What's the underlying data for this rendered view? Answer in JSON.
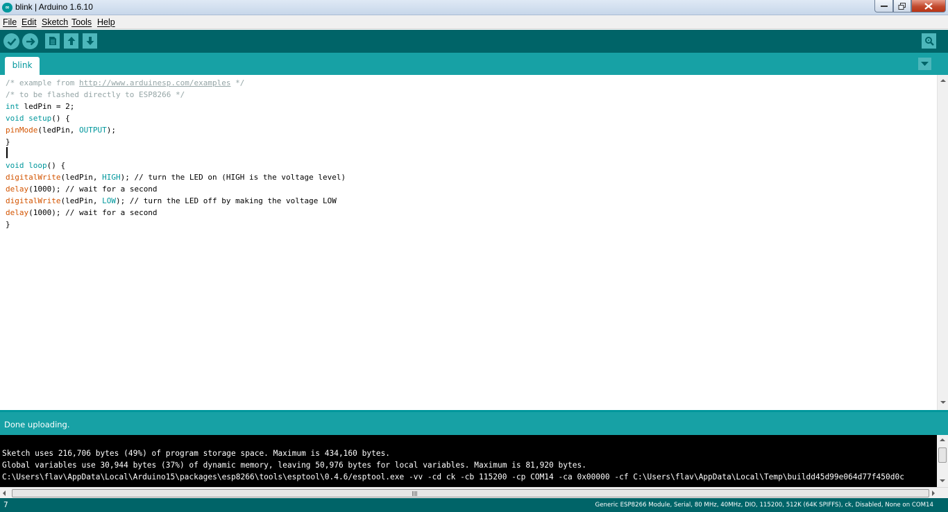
{
  "window": {
    "title": "blink | Arduino 1.6.10",
    "app_icon_text": "∞"
  },
  "menu": {
    "items": [
      "File",
      "Edit",
      "Sketch",
      "Tools",
      "Help"
    ]
  },
  "toolbar": {
    "buttons": [
      "verify-icon",
      "upload-icon",
      "new-icon",
      "open-icon",
      "save-icon"
    ],
    "serial_monitor_icon": "magnifier-icon"
  },
  "tabs": {
    "active": "blink"
  },
  "editor": {
    "lines": [
      {
        "parts": [
          {
            "t": "/* example from ",
            "c": "cmt"
          },
          {
            "t": "http://www.arduinesp.com/examples",
            "c": "link"
          },
          {
            "t": " */",
            "c": "cmt"
          }
        ]
      },
      {
        "parts": [
          {
            "t": "/* to be flashed directly to ESP8266 */",
            "c": "cmt"
          }
        ]
      },
      {
        "parts": [
          {
            "t": "int",
            "c": "kw"
          },
          {
            "t": " ledPin = 2;",
            "c": ""
          }
        ]
      },
      {
        "parts": [
          {
            "t": "void",
            "c": "kw"
          },
          {
            "t": " ",
            "c": ""
          },
          {
            "t": "setup",
            "c": "kw"
          },
          {
            "t": "() {",
            "c": ""
          }
        ]
      },
      {
        "parts": [
          {
            "t": "pinMode",
            "c": "fn"
          },
          {
            "t": "(ledPin, ",
            "c": ""
          },
          {
            "t": "OUTPUT",
            "c": "cst"
          },
          {
            "t": ");",
            "c": ""
          }
        ]
      },
      {
        "parts": [
          {
            "t": "}",
            "c": ""
          }
        ]
      },
      {
        "parts": [
          {
            "t": "",
            "c": ""
          }
        ]
      },
      {
        "parts": [
          {
            "t": "void",
            "c": "kw"
          },
          {
            "t": " ",
            "c": ""
          },
          {
            "t": "loop",
            "c": "kw"
          },
          {
            "t": "() {",
            "c": ""
          }
        ]
      },
      {
        "parts": [
          {
            "t": "digitalWrite",
            "c": "fn"
          },
          {
            "t": "(ledPin, ",
            "c": ""
          },
          {
            "t": "HIGH",
            "c": "cst"
          },
          {
            "t": "); // turn the LED on (HIGH is the voltage level)",
            "c": ""
          }
        ]
      },
      {
        "parts": [
          {
            "t": "delay",
            "c": "fn"
          },
          {
            "t": "(1000); // wait for a second",
            "c": ""
          }
        ]
      },
      {
        "parts": [
          {
            "t": "digitalWrite",
            "c": "fn"
          },
          {
            "t": "(ledPin, ",
            "c": ""
          },
          {
            "t": "LOW",
            "c": "cst"
          },
          {
            "t": "); // turn the LED off by making the voltage LOW",
            "c": ""
          }
        ]
      },
      {
        "parts": [
          {
            "t": "delay",
            "c": "fn"
          },
          {
            "t": "(1000); // wait for a second",
            "c": ""
          }
        ]
      },
      {
        "parts": [
          {
            "t": "}",
            "c": ""
          }
        ]
      }
    ]
  },
  "status": {
    "message": "Done uploading."
  },
  "console": {
    "lines": [
      "Sketch uses 216,706 bytes (49%) of program storage space. Maximum is 434,160 bytes.",
      "Global variables use 30,944 bytes (37%) of dynamic memory, leaving 50,976 bytes for local variables. Maximum is 81,920 bytes.",
      "C:\\Users\\flav\\AppData\\Local\\Arduino15\\packages\\esp8266\\tools\\esptool\\0.4.6/esptool.exe -vv -cd ck -cb 115200 -cp COM14 -ca 0x00000 -cf C:\\Users\\flav\\AppData\\Local\\Temp\\buildd45d99e064d77f450d0c"
    ]
  },
  "footer": {
    "line_number": "7",
    "board_info": "Generic ESP8266 Module, Serial, 80 MHz, 40MHz, DIO, 115200, 512K (64K SPIFFS), ck, Disabled, None on COM14"
  },
  "colors": {
    "toolbar": "#006468",
    "tabbar": "#17a1a5",
    "button": "#4db7bb",
    "keyword": "#00979c",
    "function": "#d35400",
    "comment": "#95a5a6"
  }
}
